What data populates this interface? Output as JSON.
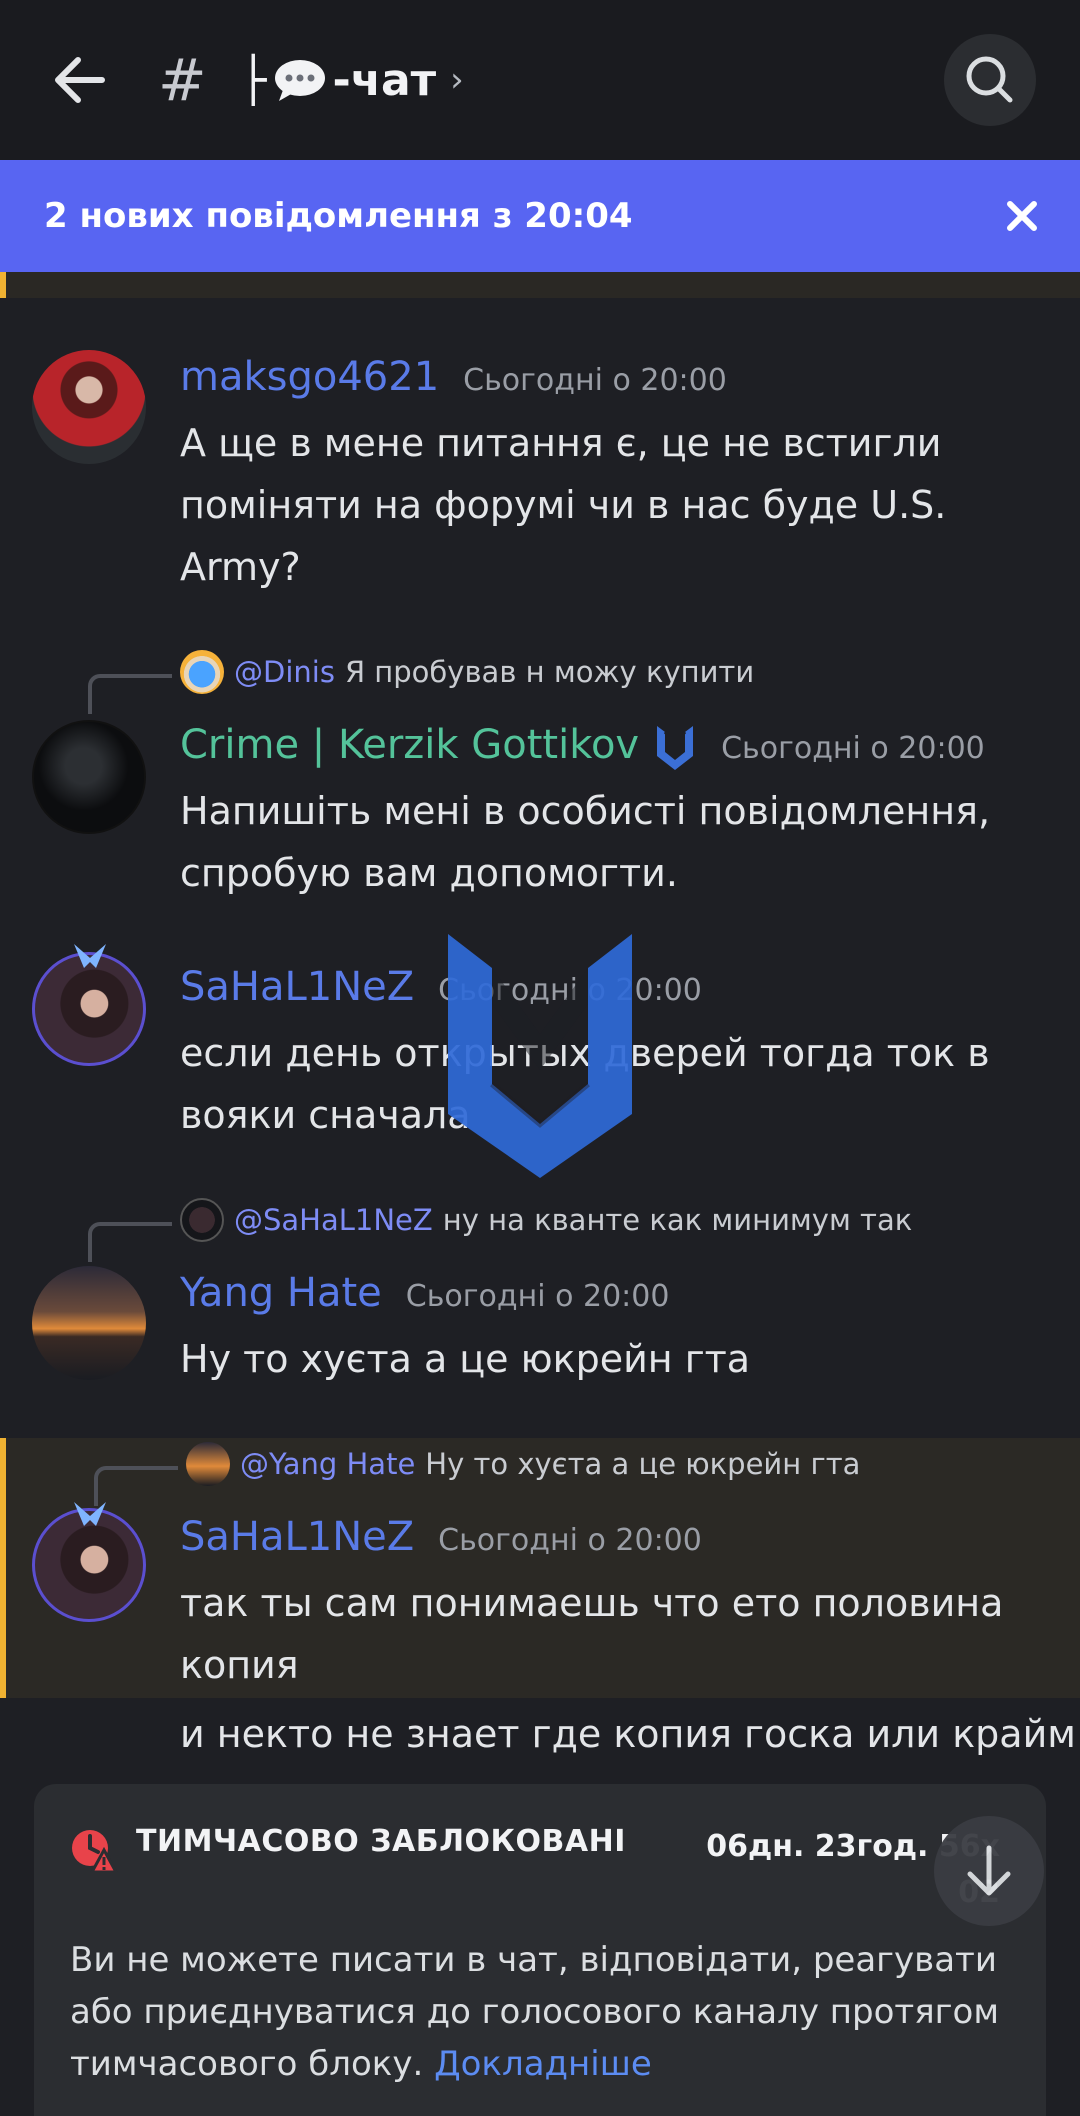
{
  "header": {
    "channel_hash": "#",
    "channel_prefix": "├",
    "channel_name": "-чат",
    "chevron": "›"
  },
  "banner": {
    "text": "2 нових повідомлення з 20:04",
    "close_icon": "close-icon"
  },
  "cut_message": {
    "text": "ну на кванте как минимум так"
  },
  "messages": [
    {
      "author": "maksgo4621",
      "timestamp": "Сьогодні о 20:00",
      "lines": [
        "А ще в мене питання є, це не встигли",
        "поміняти на форумі чи в нас буде U.S.",
        "Army?"
      ]
    },
    {
      "reply_mention": "@Dinis",
      "reply_text": "Я пробував н можу купити",
      "author": "Crime | Kerzik Gottikov",
      "timestamp": "Сьогодні о 20:00",
      "lines": [
        "Напишіть мені в особисті повідомлення,",
        "спробую вам допомогти."
      ]
    },
    {
      "author": "SaHaL1NeZ",
      "timestamp": "Сьогодні о 20:00",
      "lines": [
        "если день открытых дверей  тогда ток в",
        "вояки сначала"
      ]
    },
    {
      "reply_mention": "@SaHaL1NeZ",
      "reply_text": "ну на кванте как минимум так",
      "author": "Yang Hate",
      "timestamp": "Сьогодні о 20:00",
      "lines": [
        "Ну то хуєта а це юкрейн гта"
      ]
    },
    {
      "reply_mention": "@Yang Hate",
      "reply_text": "Ну то хуєта а це юкрейн гта",
      "author": "SaHaL1NeZ",
      "timestamp": "Сьогодні о 20:00",
      "lines": [
        "так ты сам понимаешь что ето половина",
        "копия"
      ]
    }
  ],
  "last_line": "и некто не знает где копия госка или крайм",
  "block_panel": {
    "title": "ТИМЧАСОВО ЗАБЛОКОВАНІ",
    "timer_line1": "06дн. 23год. 56х",
    "timer_line2": "02",
    "description": "Ви не можете писати в чат, відповідати, реагувати або приєднуватися до голосового каналу протягом тимчасового блоку.",
    "link": "Докладніше"
  },
  "colors": {
    "accent": "#5865f2",
    "highlight_bar": "#f0b232",
    "name_blue": "#5a7be8",
    "name_green": "#54c39a",
    "link": "#5c8cf2"
  }
}
